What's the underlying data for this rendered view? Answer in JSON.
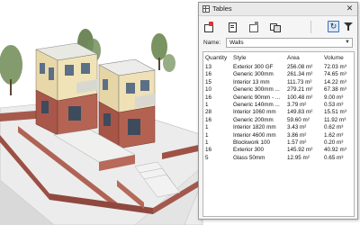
{
  "palette": {
    "title": "Tables",
    "close_glyph": "✕",
    "toolbar": {
      "icons": [
        "new-table-icon",
        "table-settings-icon",
        "export-icon",
        "duplicate-icon"
      ],
      "refresh_glyph": "↻",
      "filter_icon": "filter-icon"
    },
    "name_label": "Name:",
    "name_value": "Walls",
    "table": {
      "headers": [
        "Quantity",
        "Style",
        "Area",
        "Volume"
      ],
      "rows": [
        [
          "13",
          "Exterior 300 GF",
          "256.08 m²",
          "72.03 m³"
        ],
        [
          "16",
          "Generic 300mm",
          "261.34 m²",
          "74.65 m³"
        ],
        [
          "15",
          "Interior 13 mm",
          "111.73 m²",
          "14.22 m³"
        ],
        [
          "10",
          "Generic 300mm ...",
          "279.21 m²",
          "67.38 m³"
        ],
        [
          "16",
          "Generic 90mm - ...",
          "100.48 m²",
          "9.00 m³"
        ],
        [
          "1",
          "Generic 140mm ...",
          "3.79 m²",
          "0.53 m³"
        ],
        [
          "28",
          "Interior 1060 mm",
          "149.83 m²",
          "15.51 m³"
        ],
        [
          "16",
          "Generic 200mm",
          "59.60 m²",
          "11.92 m³"
        ],
        [
          "1",
          "Interior 1820 mm",
          "3.43 m²",
          "0.62 m³"
        ],
        [
          "1",
          "Interior 4600 mm",
          "3.86 m²",
          "1.62 m³"
        ],
        [
          "1",
          "Blockwork 100",
          "1.57 m²",
          "0.20 m³"
        ],
        [
          "16",
          "Exterior 300",
          "145.92 m²",
          "40.92 m³"
        ],
        [
          "5",
          "Glass 50mm",
          "12.95 m²",
          "0.65 m³"
        ]
      ]
    }
  }
}
